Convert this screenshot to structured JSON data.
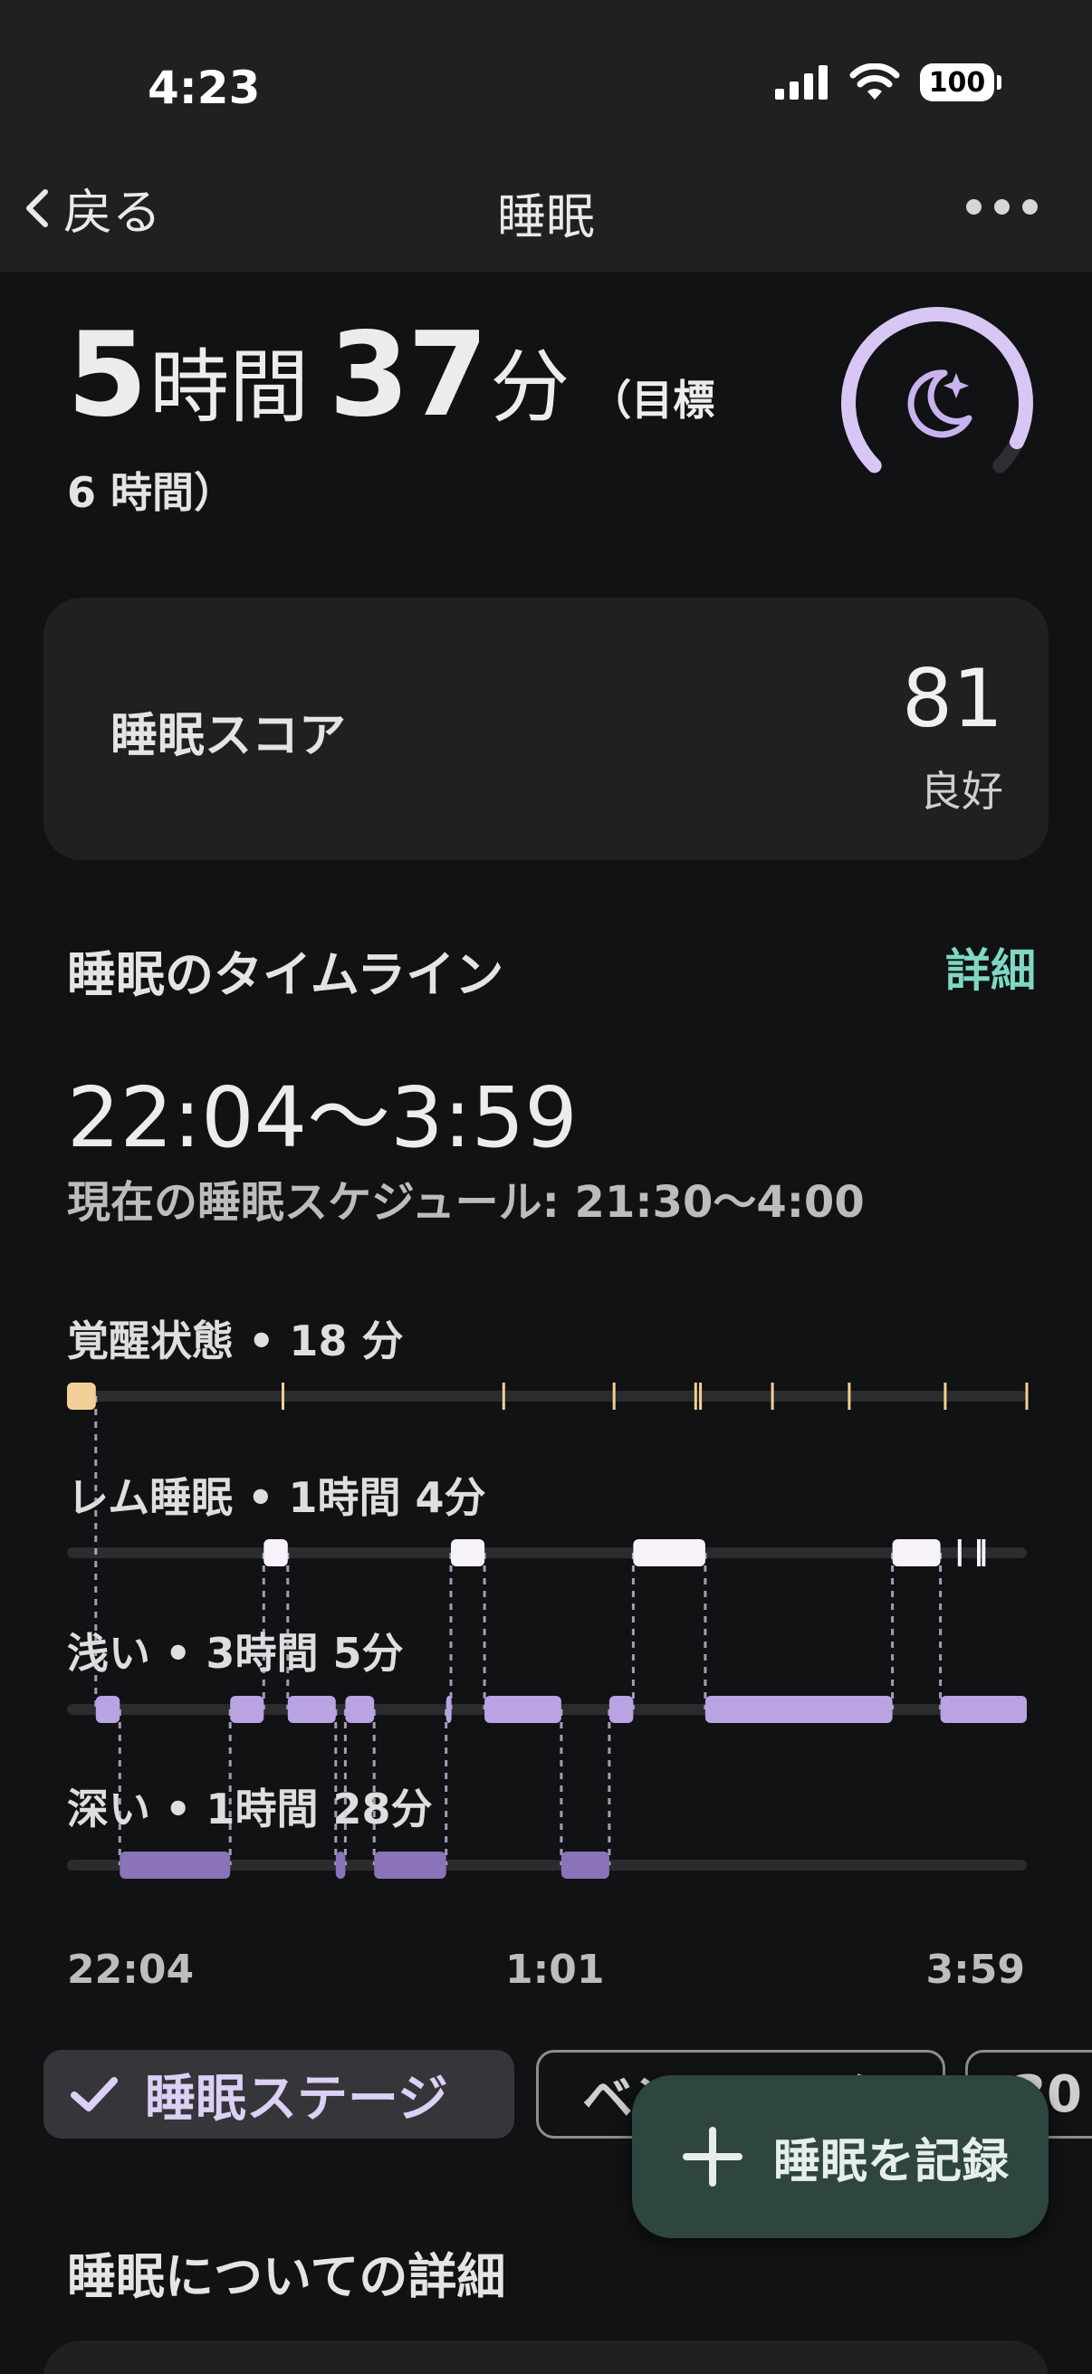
{
  "status_bar": {
    "time": "4:23",
    "battery": "100"
  },
  "nav": {
    "back_label": "戻る",
    "title": "睡眠"
  },
  "duration": {
    "hours_value": "5",
    "hours_unit": "時間",
    "minutes_value": "37",
    "minutes_unit": "分",
    "goal_line1": "（目標",
    "goal_line2": "6 時間）",
    "goal_progress_fraction": 0.93
  },
  "score": {
    "label": "睡眠スコア",
    "value": "81",
    "rating": "良好"
  },
  "timeline": {
    "title": "睡眠のタイムライン",
    "detail_link": "詳細",
    "range": "22:04〜3:59",
    "schedule": "現在の睡眠スケジュール: 21:30〜4:00",
    "stages": [
      {
        "label": "覚醒状態 • 18 分"
      },
      {
        "label": "レム睡眠 • 1時間 4分"
      },
      {
        "label": "浅い • 3時間 5分"
      },
      {
        "label": "深い • 1時間 28分"
      }
    ],
    "axis": {
      "start": "22:04",
      "mid": "1:01",
      "end": "3:59"
    }
  },
  "chips": {
    "active": "睡眠ステージ",
    "second": "ベンチマーク",
    "third": "30"
  },
  "fab": {
    "label": "睡眠を記録"
  },
  "details_title": "睡眠についての詳細",
  "colors": {
    "accent_lavender": "#b9a3e3",
    "deep": "#8a73b8",
    "awake": "#f4cf97",
    "rem": "#f7f1fb",
    "link": "#7fd7c4"
  },
  "chart_data": {
    "type": "hypnogram",
    "x_range": [
      "22:04",
      "3:59"
    ],
    "stages": [
      "覚醒状態",
      "レム睡眠",
      "浅い",
      "深い"
    ],
    "segments": [
      {
        "stage": 0,
        "start": 0.0,
        "end": 0.03
      },
      {
        "stage": 2,
        "start": 0.03,
        "end": 0.055
      },
      {
        "stage": 3,
        "start": 0.055,
        "end": 0.17
      },
      {
        "stage": 2,
        "start": 0.17,
        "end": 0.205
      },
      {
        "stage": 1,
        "start": 0.205,
        "end": 0.23
      },
      {
        "stage": 2,
        "start": 0.23,
        "end": 0.28
      },
      {
        "stage": 3,
        "start": 0.28,
        "end": 0.29
      },
      {
        "stage": 2,
        "start": 0.29,
        "end": 0.32
      },
      {
        "stage": 3,
        "start": 0.32,
        "end": 0.395
      },
      {
        "stage": 2,
        "start": 0.395,
        "end": 0.4
      },
      {
        "stage": 1,
        "start": 0.4,
        "end": 0.435
      },
      {
        "stage": 2,
        "start": 0.435,
        "end": 0.515
      },
      {
        "stage": 3,
        "start": 0.515,
        "end": 0.565
      },
      {
        "stage": 2,
        "start": 0.565,
        "end": 0.59
      },
      {
        "stage": 1,
        "start": 0.59,
        "end": 0.665
      },
      {
        "stage": 2,
        "start": 0.665,
        "end": 0.86
      },
      {
        "stage": 1,
        "start": 0.86,
        "end": 0.91
      },
      {
        "stage": 2,
        "start": 0.91,
        "end": 1.0
      }
    ],
    "awake_ticks": [
      0.225,
      0.455,
      0.57,
      0.655,
      0.66,
      0.735,
      0.815,
      0.915,
      1.0
    ],
    "rem_ticks": [
      0.93,
      0.95,
      0.955
    ]
  }
}
